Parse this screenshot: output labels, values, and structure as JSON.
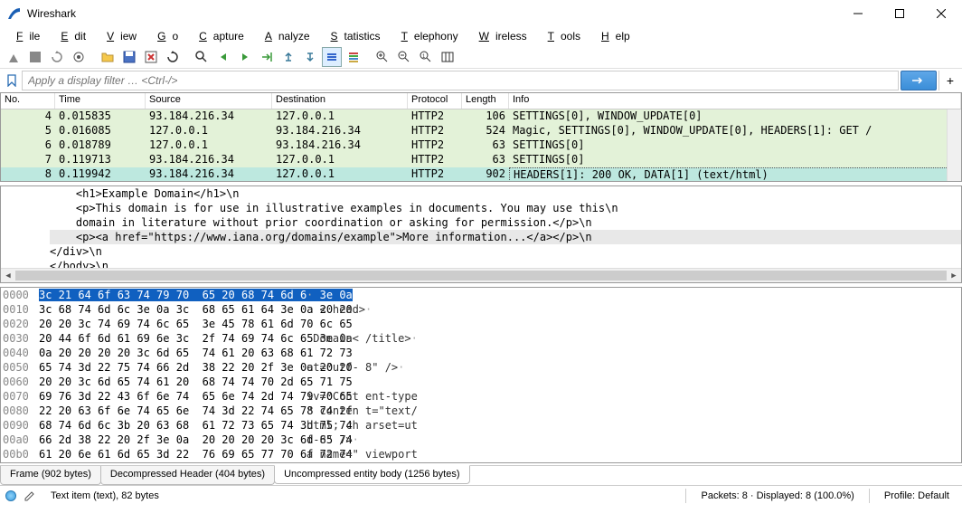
{
  "title": "Wireshark",
  "menu": [
    "File",
    "Edit",
    "View",
    "Go",
    "Capture",
    "Analyze",
    "Statistics",
    "Telephony",
    "Wireless",
    "Tools",
    "Help"
  ],
  "filter_placeholder": "Apply a display filter … <Ctrl-/>",
  "columns": {
    "no": "No.",
    "time": "Time",
    "src": "Source",
    "dst": "Destination",
    "proto": "Protocol",
    "len": "Length",
    "info": "Info"
  },
  "packets": [
    {
      "no": "4",
      "time": "0.015835",
      "src": "93.184.216.34",
      "dst": "127.0.0.1",
      "proto": "HTTP2",
      "len": "106",
      "info": "SETTINGS[0], WINDOW_UPDATE[0]"
    },
    {
      "no": "5",
      "time": "0.016085",
      "src": "127.0.0.1",
      "dst": "93.184.216.34",
      "proto": "HTTP2",
      "len": "524",
      "info": "Magic, SETTINGS[0], WINDOW_UPDATE[0], HEADERS[1]: GET /"
    },
    {
      "no": "6",
      "time": "0.018789",
      "src": "127.0.0.1",
      "dst": "93.184.216.34",
      "proto": "HTTP2",
      "len": "63",
      "info": "SETTINGS[0]"
    },
    {
      "no": "7",
      "time": "0.119713",
      "src": "93.184.216.34",
      "dst": "127.0.0.1",
      "proto": "HTTP2",
      "len": "63",
      "info": "SETTINGS[0]"
    },
    {
      "no": "8",
      "time": "0.119942",
      "src": "93.184.216.34",
      "dst": "127.0.0.1",
      "proto": "HTTP2",
      "len": "902",
      "info": "HEADERS[1]: 200 OK, DATA[1] (text/html)"
    }
  ],
  "selected_packet_index": 4,
  "detail_lines": [
    {
      "t": "    <h1>Example Domain</h1>\\n",
      "hl": false
    },
    {
      "t": "    <p>This domain is for use in illustrative examples in documents. You may use this\\n",
      "hl": false
    },
    {
      "t": "    domain in literature without prior coordination or asking for permission.</p>\\n",
      "hl": false
    },
    {
      "t": "    <p><a href=\"https://www.iana.org/domains/example\">More information...</a></p>\\n",
      "hl": true
    },
    {
      "t": "</div>\\n",
      "hl": false
    },
    {
      "t": "</body>\\n",
      "hl": false
    }
  ],
  "hex": [
    {
      "off": "0000",
      "h1": "3c 21 64 6f 63 74 79 70",
      "h2": "65 20 68 74 6d 6c 3e 0a",
      "a": "<!doctyp e html>·"
    },
    {
      "off": "0010",
      "h1": "3c 68 74 6d 6c 3e 0a 3c",
      "h2": "68 65 61 64 3e 0a 20 20",
      "a": "<html>· < head>·  "
    },
    {
      "off": "0020",
      "h1": "20 20 3c 74 69 74 6c 65",
      "h2": "3e 45 78 61 6d 70 6c 65",
      "a": "  <title >Example"
    },
    {
      "off": "0030",
      "h1": "20 44 6f 6d 61 69 6e 3c",
      "h2": "2f 74 69 74 6c 65 3e 0a",
      "a": " Domain< /title>·"
    },
    {
      "off": "0040",
      "h1": "0a 20 20 20 20 3c 6d 65",
      "h2": "74 61 20 63 68 61 72 73",
      "a": "·    <me ta chars"
    },
    {
      "off": "0050",
      "h1": "65 74 3d 22 75 74 66 2d",
      "h2": "38 22 20 2f 3e 0a 20 20",
      "a": "et=\"utf- 8\" />·  "
    },
    {
      "off": "0060",
      "h1": "20 20 3c 6d 65 74 61 20",
      "h2": "68 74 74 70 2d 65 71 75",
      "a": "  <meta  http-equ"
    },
    {
      "off": "0070",
      "h1": "69 76 3d 22 43 6f 6e 74",
      "h2": "65 6e 74 2d 74 79 70 65",
      "a": "iv=\"Cont ent-type"
    },
    {
      "off": "0080",
      "h1": "22 20 63 6f 6e 74 65 6e",
      "h2": "74 3d 22 74 65 78 74 2f",
      "a": "\" conten t=\"text/"
    },
    {
      "off": "0090",
      "h1": "68 74 6d 6c 3b 20 63 68",
      "h2": "61 72 73 65 74 3d 75 74",
      "a": "html; ch arset=ut"
    },
    {
      "off": "00a0",
      "h1": "66 2d 38 22 20 2f 3e 0a",
      "h2": "20 20 20 20 3c 6d 65 74",
      "a": "f-8\" />·     <met"
    },
    {
      "off": "00b0",
      "h1": "61 20 6e 61 6d 65 3d 22",
      "h2": "76 69 65 77 70 6f 72 74",
      "a": "a name=\" viewport"
    }
  ],
  "tabs": [
    {
      "label": "Frame (902 bytes)"
    },
    {
      "label": "Decompressed Header (404 bytes)"
    },
    {
      "label": "Uncompressed entity body (1256 bytes)"
    }
  ],
  "active_tab": 2,
  "status": {
    "left": "Text item (text), 82 bytes",
    "center": "Packets: 8 · Displayed: 8 (100.0%)",
    "right": "Profile: Default"
  }
}
